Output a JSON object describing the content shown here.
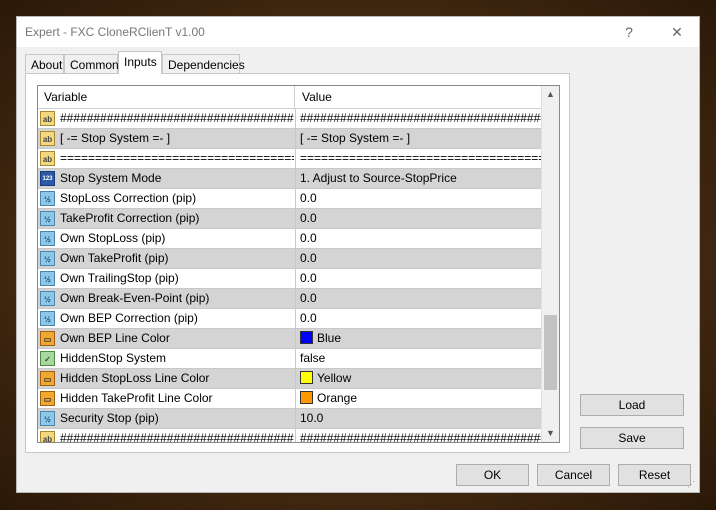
{
  "window": {
    "title": "Expert - FXC CloneRClienT v1.00",
    "help": "?",
    "close": "✕"
  },
  "tabs": [
    "About",
    "Common",
    "Inputs",
    "Dependencies"
  ],
  "active_tab": "Inputs",
  "grid": {
    "headers": {
      "variable": "Variable",
      "value": "Value"
    },
    "rows": [
      {
        "icon": "ab",
        "icon_label": "ab",
        "variable": "########################################",
        "value": "########################################"
      },
      {
        "icon": "ab",
        "icon_label": "ab",
        "variable": "[ -= Stop System =- ]",
        "value": "[ -= Stop System =- ]"
      },
      {
        "icon": "ab",
        "icon_label": "ab",
        "variable": "=========================================",
        "value": "========================================="
      },
      {
        "icon": "n123",
        "icon_label": "123",
        "variable": "Stop System Mode",
        "value": "1. Adjust to Source-StopPrice"
      },
      {
        "icon": "frac",
        "icon_label": "½",
        "variable": "StopLoss Correction (pip)",
        "value": "0.0"
      },
      {
        "icon": "frac",
        "icon_label": "½",
        "variable": "TakeProfit Correction (pip)",
        "value": "0.0"
      },
      {
        "icon": "frac",
        "icon_label": "½",
        "variable": "Own StopLoss (pip)",
        "value": "0.0"
      },
      {
        "icon": "frac",
        "icon_label": "½",
        "variable": "Own TakeProfit (pip)",
        "value": "0.0"
      },
      {
        "icon": "frac",
        "icon_label": "½",
        "variable": "Own TrailingStop (pip)",
        "value": "0.0"
      },
      {
        "icon": "frac",
        "icon_label": "½",
        "variable": "Own Break-Even-Point (pip)",
        "value": "0.0"
      },
      {
        "icon": "frac",
        "icon_label": "½",
        "variable": "Own BEP Correction (pip)",
        "value": "0.0"
      },
      {
        "icon": "color",
        "icon_label": "▭",
        "variable": "Own BEP Line Color",
        "value": "Blue",
        "swatch": "#0000ff"
      },
      {
        "icon": "bool",
        "icon_label": "✓",
        "variable": "HiddenStop System",
        "value": "false"
      },
      {
        "icon": "color",
        "icon_label": "▭",
        "variable": "Hidden StopLoss Line Color",
        "value": "Yellow",
        "swatch": "#ffff00"
      },
      {
        "icon": "color",
        "icon_label": "▭",
        "variable": "Hidden TakeProfit Line Color",
        "value": "Orange",
        "swatch": "#ff9900"
      },
      {
        "icon": "frac",
        "icon_label": "½",
        "variable": "Security Stop (pip)",
        "value": "10.0"
      },
      {
        "icon": "ab",
        "icon_label": "ab",
        "variable": "########################################",
        "value": "########################################"
      }
    ]
  },
  "side_buttons": {
    "load": "Load",
    "save": "Save"
  },
  "footer_buttons": {
    "ok": "OK",
    "cancel": "Cancel",
    "reset": "Reset"
  },
  "scrollbar": {
    "up": "▲",
    "down": "▼"
  }
}
